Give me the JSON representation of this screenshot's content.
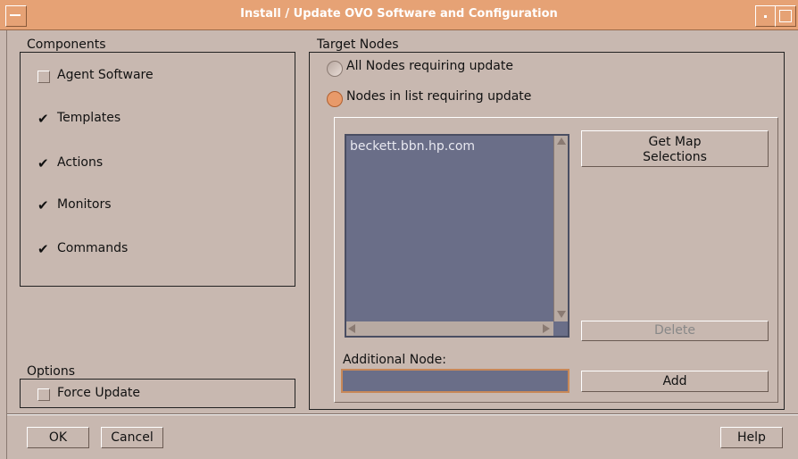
{
  "window": {
    "title": "Install / Update OVO Software and Configuration"
  },
  "components": {
    "label": "Components",
    "items": [
      {
        "label": "Agent Software",
        "checked": false
      },
      {
        "label": "Templates",
        "checked": true
      },
      {
        "label": "Actions",
        "checked": true
      },
      {
        "label": "Monitors",
        "checked": true
      },
      {
        "label": "Commands",
        "checked": true
      }
    ]
  },
  "options": {
    "label": "Options",
    "force_update": {
      "label": "Force Update",
      "checked": false
    }
  },
  "target_nodes": {
    "label": "Target Nodes",
    "radios": [
      {
        "label": "All Nodes requiring update",
        "selected": false
      },
      {
        "label": "Nodes in list requiring update",
        "selected": true
      }
    ],
    "node_list": [
      "beckett.bbn.hp.com"
    ],
    "get_map_selections_label": "Get Map\nSelections",
    "delete_label": "Delete",
    "additional_node_label": "Additional Node:",
    "additional_node_value": "",
    "add_label": "Add"
  },
  "footer": {
    "ok_label": "OK",
    "cancel_label": "Cancel",
    "help_label": "Help"
  },
  "colors": {
    "title_bar": "#e6a275",
    "window_bg": "#c8b8b0",
    "list_bg": "#6a6e88",
    "radio_selected": "#e89a6a"
  }
}
